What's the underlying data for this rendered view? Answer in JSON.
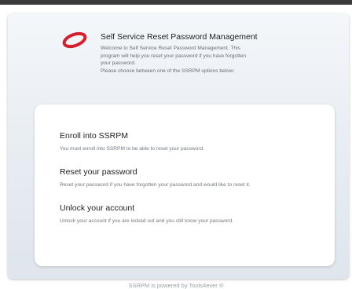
{
  "header": {
    "title": "Self Service Reset Password Management",
    "description_lines": [
      "Welcome to Self Service Reset Password Management. This",
      "program will help you reset your password if you have forgotten",
      "your password.",
      "Please choose between one of the SSRPM options below:"
    ]
  },
  "options": [
    {
      "title": "Enroll into SSRPM",
      "description": "You must enroll into SSRPM to be able to reset your password."
    },
    {
      "title": "Reset your password",
      "description": "Reset your password if you have forgotten your password and would like to reset it."
    },
    {
      "title": "Unlock your account",
      "description": "Unlock your account if you are locked out and you still know your password."
    }
  ],
  "footer": {
    "text": "SSRPM is powered by Tools4ever ®"
  },
  "colors": {
    "logo_red": "#d3202a",
    "panel_bg": "#e9eef3",
    "card_bg": "#ffffff"
  },
  "icons": {
    "logo": "red-ring-logo-icon"
  }
}
